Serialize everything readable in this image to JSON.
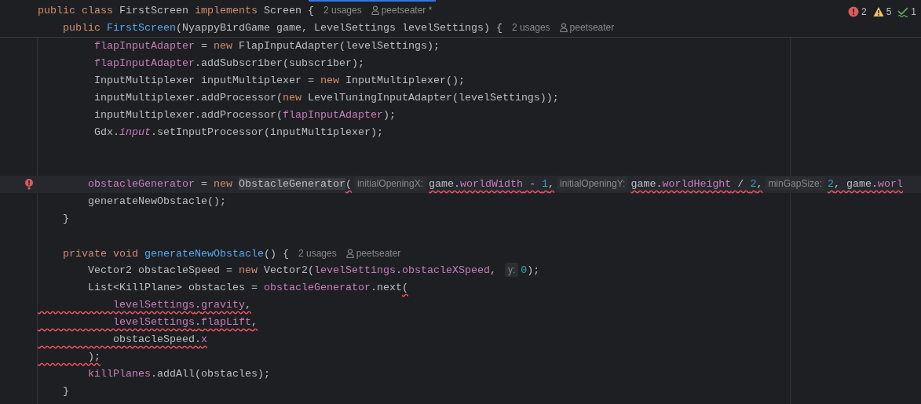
{
  "inspections": [
    {
      "kind": "error",
      "count": "2"
    },
    {
      "kind": "warning",
      "count": "5"
    },
    {
      "kind": "typo",
      "count": "1"
    }
  ],
  "sticky_lines": [
    {
      "tokens": [
        {
          "kind": "kw",
          "t": "public class "
        },
        {
          "kind": "plain",
          "t": "FirstScreen "
        },
        {
          "kind": "kw",
          "t": "implements "
        },
        {
          "kind": "plain",
          "t": "Screen {"
        },
        {
          "kind": "usages",
          "t": "2 usages"
        },
        {
          "kind": "author",
          "t": "peetseater *"
        }
      ]
    },
    {
      "tokens": [
        {
          "kind": "kw",
          "t": "    public "
        },
        {
          "kind": "decl",
          "t": "FirstScreen"
        },
        {
          "kind": "plain",
          "t": "(NyappyBirdGame game, LevelSettings levelSettings) {"
        },
        {
          "kind": "usages",
          "t": "2 usages"
        },
        {
          "kind": "author",
          "t": "peetseater"
        }
      ]
    }
  ],
  "lines": [
    {
      "tokens": [
        {
          "kind": "field",
          "t": "         flapInputAdapter"
        },
        {
          "kind": "plain",
          "t": " = "
        },
        {
          "kind": "kw",
          "t": "new "
        },
        {
          "kind": "plain",
          "t": "FlapInputAdapter(levelSettings);"
        }
      ]
    },
    {
      "tokens": [
        {
          "kind": "field",
          "t": "         flapInputAdapter"
        },
        {
          "kind": "plain",
          "t": ".addSubscriber(subscriber);"
        }
      ]
    },
    {
      "tokens": [
        {
          "kind": "plain",
          "t": "         InputMultiplexer inputMultiplexer = "
        },
        {
          "kind": "kw",
          "t": "new "
        },
        {
          "kind": "plain",
          "t": "InputMultiplexer();"
        }
      ]
    },
    {
      "tokens": [
        {
          "kind": "plain",
          "t": "         inputMultiplexer.addProcessor("
        },
        {
          "kind": "kw",
          "t": "new "
        },
        {
          "kind": "plain",
          "t": "LevelTuningInputAdapter(levelSettings));"
        }
      ]
    },
    {
      "tokens": [
        {
          "kind": "plain",
          "t": "         inputMultiplexer.addProcessor("
        },
        {
          "kind": "field",
          "t": "flapInputAdapter"
        },
        {
          "kind": "plain",
          "t": ");"
        }
      ]
    },
    {
      "tokens": [
        {
          "kind": "plain",
          "t": "         Gdx."
        },
        {
          "kind": "static",
          "t": "input"
        },
        {
          "kind": "plain",
          "t": ".setInputProcessor(inputMultiplexer);"
        }
      ]
    },
    {
      "kind": "blank"
    },
    {
      "kind": "blank"
    },
    {
      "current": true,
      "gutter_error": true,
      "tokens": [
        {
          "kind": "field",
          "t": "        obstacleGenerator"
        },
        {
          "kind": "plain",
          "t": " = "
        },
        {
          "kind": "kw",
          "t": "new "
        },
        {
          "kind": "plain",
          "t": "ObstacleGenerator",
          "highlight": true
        },
        {
          "kind": "plain",
          "t": "(",
          "error": true
        },
        {
          "kind": "hint",
          "t": "initialOpeningX:"
        },
        {
          "kind": "plain",
          "t": "game.",
          "error": true
        },
        {
          "kind": "field",
          "t": "worldWidth",
          "error": true
        },
        {
          "kind": "plain",
          "t": " - ",
          "error": true
        },
        {
          "kind": "num",
          "t": "1",
          "error": true
        },
        {
          "kind": "plain",
          "t": ",",
          "error": true
        },
        {
          "kind": "hint",
          "t": "initialOpeningY:"
        },
        {
          "kind": "plain",
          "t": "game.",
          "error": true
        },
        {
          "kind": "field",
          "t": "worldHeight",
          "error": true
        },
        {
          "kind": "plain",
          "t": " / ",
          "error": true
        },
        {
          "kind": "num",
          "t": "2",
          "error": true
        },
        {
          "kind": "plain",
          "t": ",",
          "error": true
        },
        {
          "kind": "hint",
          "t": "minGapSize:"
        },
        {
          "kind": "num",
          "t": "2",
          "error": true
        },
        {
          "kind": "plain",
          "t": ", game.",
          "error": true
        },
        {
          "kind": "field",
          "t": "worl",
          "error": true
        }
      ]
    },
    {
      "tokens": [
        {
          "kind": "plain",
          "t": "        generateNewObstacle();"
        }
      ]
    },
    {
      "tokens": [
        {
          "kind": "plain",
          "t": "    }"
        }
      ]
    },
    {
      "kind": "blank"
    },
    {
      "tokens": [
        {
          "kind": "kw",
          "t": "    private void "
        },
        {
          "kind": "decl",
          "t": "generateNewObstacle"
        },
        {
          "kind": "plain",
          "t": "() {"
        },
        {
          "kind": "usages",
          "t": "2 usages"
        },
        {
          "kind": "author",
          "t": "peetseater"
        }
      ]
    },
    {
      "tokens": [
        {
          "kind": "plain",
          "t": "        Vector2 obstacleSpeed = "
        },
        {
          "kind": "kw",
          "t": "new "
        },
        {
          "kind": "plain",
          "t": "Vector2("
        },
        {
          "kind": "field",
          "t": "levelSettings"
        },
        {
          "kind": "plain",
          "t": "."
        },
        {
          "kind": "field",
          "t": "obstacleXSpeed"
        },
        {
          "kind": "plain",
          "t": ", "
        },
        {
          "kind": "hint",
          "t": "y:"
        },
        {
          "kind": "num",
          "t": "0"
        },
        {
          "kind": "plain",
          "t": ");"
        }
      ]
    },
    {
      "tokens": [
        {
          "kind": "plain",
          "t": "        List<KillPlane> obstacles = "
        },
        {
          "kind": "field",
          "t": "obstacleGenerator"
        },
        {
          "kind": "plain",
          "t": ".next"
        },
        {
          "kind": "plain",
          "t": "(",
          "error": true
        }
      ]
    },
    {
      "error": true,
      "tokens": [
        {
          "kind": "field",
          "t": "            levelSettings"
        },
        {
          "kind": "plain",
          "t": "."
        },
        {
          "kind": "field",
          "t": "gravity"
        },
        {
          "kind": "plain",
          "t": ","
        }
      ]
    },
    {
      "error": true,
      "tokens": [
        {
          "kind": "field",
          "t": "            levelSettings"
        },
        {
          "kind": "plain",
          "t": "."
        },
        {
          "kind": "field",
          "t": "flapLift"
        },
        {
          "kind": "plain",
          "t": ","
        }
      ]
    },
    {
      "error": true,
      "tokens": [
        {
          "kind": "plain",
          "t": "            obstacleSpeed."
        },
        {
          "kind": "field",
          "t": "x"
        }
      ]
    },
    {
      "error": true,
      "tokens": [
        {
          "kind": "plain",
          "t": "        );"
        }
      ]
    },
    {
      "tokens": [
        {
          "kind": "field",
          "t": "        killPlanes"
        },
        {
          "kind": "plain",
          "t": ".addAll(obstacles);"
        }
      ]
    },
    {
      "tokens": [
        {
          "kind": "plain",
          "t": "    }"
        }
      ]
    }
  ]
}
